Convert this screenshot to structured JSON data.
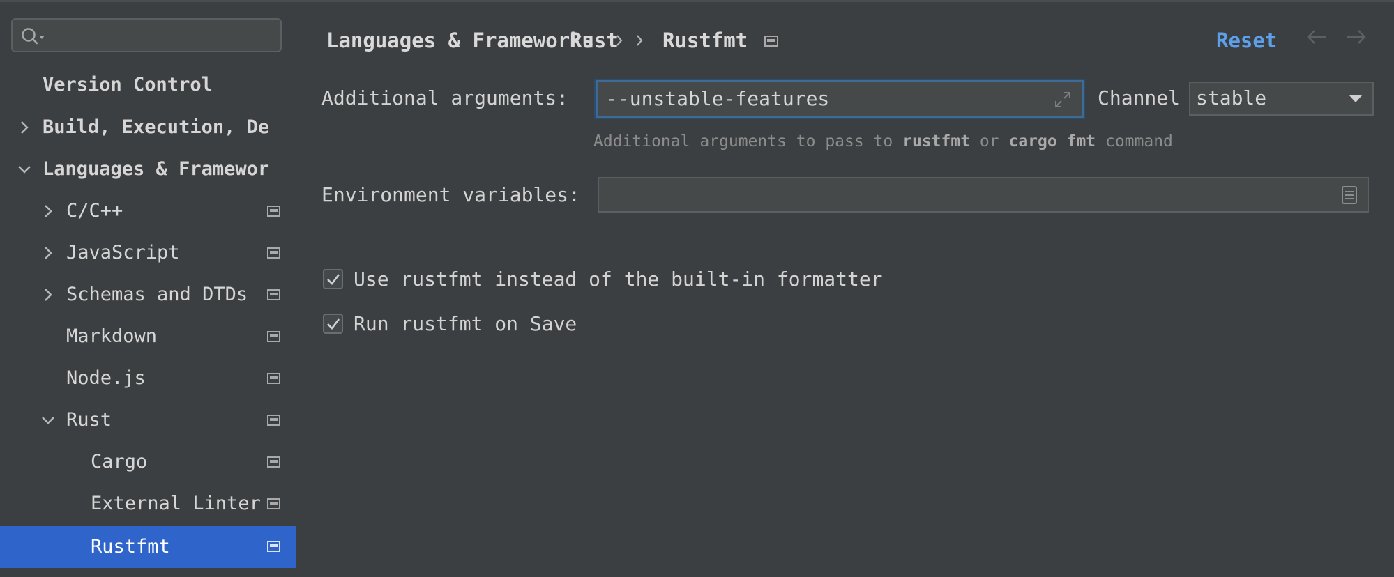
{
  "sidebar": {
    "search": {
      "value": "",
      "placeholder": ""
    },
    "items": [
      {
        "label": "Version Control"
      },
      {
        "label": "Build, Execution, De"
      },
      {
        "label": "Languages & Framewor"
      },
      {
        "label": "C/C++"
      },
      {
        "label": "JavaScript"
      },
      {
        "label": "Schemas and DTDs"
      },
      {
        "label": "Markdown"
      },
      {
        "label": "Node.js"
      },
      {
        "label": "Rust"
      },
      {
        "label": "Cargo"
      },
      {
        "label": "External Linter"
      },
      {
        "label": "Rustfmt"
      }
    ]
  },
  "header": {
    "breadcrumb": [
      "Languages & Frameworks",
      "Rust",
      "Rustfmt"
    ],
    "reset_label": "Reset"
  },
  "form": {
    "additional_arguments": {
      "label": "Additional arguments:",
      "value": "--unstable-features",
      "hint_prefix": "Additional arguments to pass to",
      "hint_rustfmt": "rustfmt",
      "hint_or": "or",
      "hint_cargo": "cargo fmt",
      "hint_suffix": "command"
    },
    "channel": {
      "label": "Channel",
      "value": "stable"
    },
    "environment_variables": {
      "label": "Environment variables:",
      "value": ""
    },
    "use_rustfmt": {
      "label": "Use rustfmt instead of the built-in formatter",
      "checked": true
    },
    "run_on_save": {
      "label": "Run rustfmt on Save",
      "checked": true
    }
  },
  "colors": {
    "selection": "#2f65ca",
    "link": "#5e9fea",
    "background": "#3c3f41"
  }
}
